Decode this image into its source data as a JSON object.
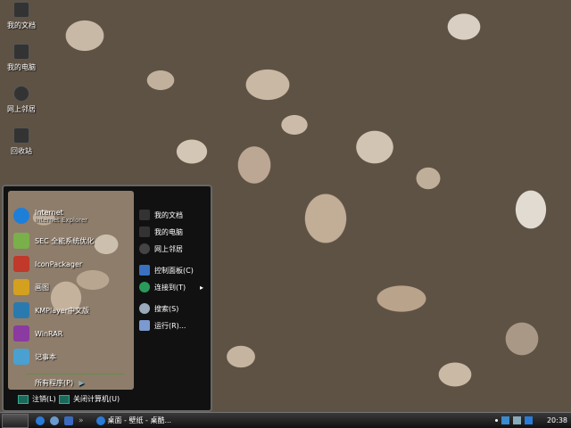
{
  "desktop_icons": [
    {
      "label": "我的文档",
      "icon": "documents-icon"
    },
    {
      "label": "我的电脑",
      "icon": "computer-icon"
    },
    {
      "label": "网上邻居",
      "icon": "network-icon"
    },
    {
      "label": "回收站",
      "icon": "recycle-bin-icon"
    }
  ],
  "start_menu": {
    "pinned": [
      {
        "label": "Internet",
        "sublabel": "Internet Explorer",
        "icon": "ie-icon",
        "color": "#1e7fd8"
      },
      {
        "label": "SEC 全能系统优化",
        "icon": "sec-icon",
        "color": "#7ab04a"
      },
      {
        "label": "IconPackager",
        "icon": "iconpackager-icon",
        "color": "#c0392b"
      },
      {
        "label": "画图",
        "icon": "paint-icon",
        "color": "#d4a020"
      },
      {
        "label": "KMPlayer中文版",
        "icon": "kmplayer-icon",
        "color": "#2a7ab0"
      },
      {
        "label": "WinRAR",
        "icon": "winrar-icon",
        "color": "#8a3aa0"
      },
      {
        "label": "记事本",
        "icon": "notepad-icon",
        "color": "#4aa0d0"
      }
    ],
    "all_programs": "所有程序(P)",
    "right": [
      {
        "label": "我的文档",
        "icon": "documents-icon",
        "color": "#333"
      },
      {
        "label": "我的电脑",
        "icon": "computer-icon",
        "color": "#333"
      },
      {
        "label": "网上邻居",
        "icon": "network-icon",
        "color": "#444"
      },
      {
        "label": "控制面板(C)",
        "icon": "control-panel-icon",
        "color": "#3a70c0"
      },
      {
        "label": "连接到(T)",
        "icon": "connect-icon",
        "color": "#2a9a5a",
        "arrow": "▸"
      },
      {
        "label": "搜索(S)",
        "icon": "search-icon",
        "color": "#9ab"
      },
      {
        "label": "运行(R)...",
        "icon": "run-icon",
        "color": "#7a9ad0"
      }
    ],
    "logoff": "注销(L)",
    "shutdown": "关闭计算机(U)"
  },
  "taskbar": {
    "task_label": "桌面 - 壁纸 - 桌酷...",
    "clock": "20:38",
    "overflow": "»"
  }
}
